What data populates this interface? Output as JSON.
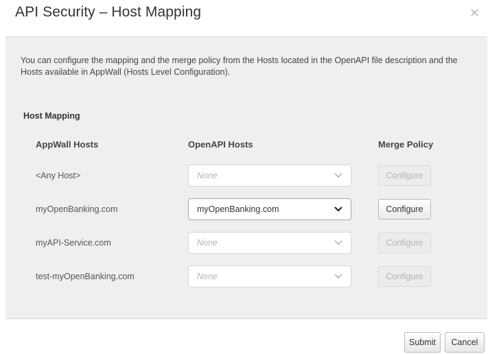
{
  "dialog": {
    "title": "API Security – Host Mapping",
    "close_icon": "close-icon",
    "close_glyph": "×"
  },
  "description": "You can configure the mapping and the merge policy from the Hosts located in the OpenAPI file description and the Hosts available in AppWall (Hosts Level Configuration).",
  "section_label": "Host Mapping",
  "columns": {
    "appwall_hosts": "AppWall Hosts",
    "openapi_hosts": "OpenAPI Hosts",
    "merge_policy": "Merge Policy"
  },
  "rows": [
    {
      "host": "<Any Host>",
      "openapi_host": "None",
      "is_placeholder": true,
      "configure_label": "Configure",
      "configure_enabled": false
    },
    {
      "host": "myOpenBanking.com",
      "openapi_host": "myOpenBanking.com",
      "is_placeholder": false,
      "configure_label": "Configure",
      "configure_enabled": true
    },
    {
      "host": "myAPI-Service.com",
      "openapi_host": "None",
      "is_placeholder": true,
      "configure_label": "Configure",
      "configure_enabled": false
    },
    {
      "host": "test-myOpenBanking.com",
      "openapi_host": "None",
      "is_placeholder": true,
      "configure_label": "Configure",
      "configure_enabled": false
    }
  ],
  "footer": {
    "submit_label": "Submit",
    "cancel_label": "Cancel"
  },
  "colors": {
    "panel_bg": "#efefef",
    "disabled_text": "#b3b3b3",
    "placeholder_text": "#b5b5b5"
  }
}
